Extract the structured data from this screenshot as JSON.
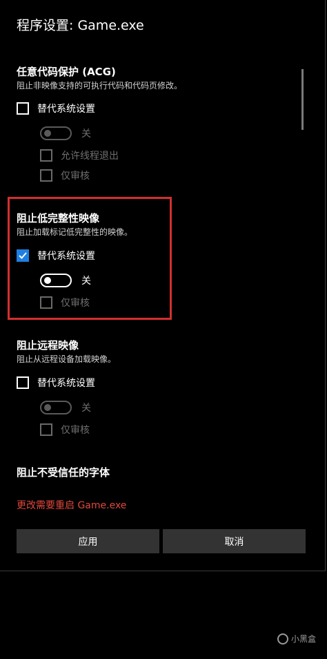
{
  "window": {
    "title": "程序设置: Game.exe"
  },
  "sections": [
    {
      "title": "任意代码保护 (ACG)",
      "description": "阻止非映像支持的可执行代码和代码页修改。",
      "override_label": "替代系统设置",
      "override_checked": false,
      "toggle_state": "关",
      "toggle_on": false,
      "extra_option": "允许线程退出",
      "audit_label": "仅审核"
    },
    {
      "title": "阻止低完整性映像",
      "description": "阻止加载标记低完整性的映像。",
      "override_label": "替代系统设置",
      "override_checked": true,
      "toggle_state": "关",
      "toggle_on": false,
      "audit_label": "仅审核"
    },
    {
      "title": "阻止远程映像",
      "description": "阻止从远程设备加载映像。",
      "override_label": "替代系统设置",
      "override_checked": false,
      "toggle_state": "关",
      "toggle_on": false,
      "audit_label": "仅审核"
    },
    {
      "title": "阻止不受信任的字体"
    }
  ],
  "footer": {
    "restart_note": "更改需要重启 Game.exe",
    "apply_label": "应用",
    "cancel_label": "取消"
  },
  "watermark": {
    "text": "小黑盒"
  },
  "colors": {
    "accent": "#1f7fe0",
    "highlight_box": "#d32f2f",
    "warning_text": "#e0473c",
    "button_bg": "#333333"
  }
}
